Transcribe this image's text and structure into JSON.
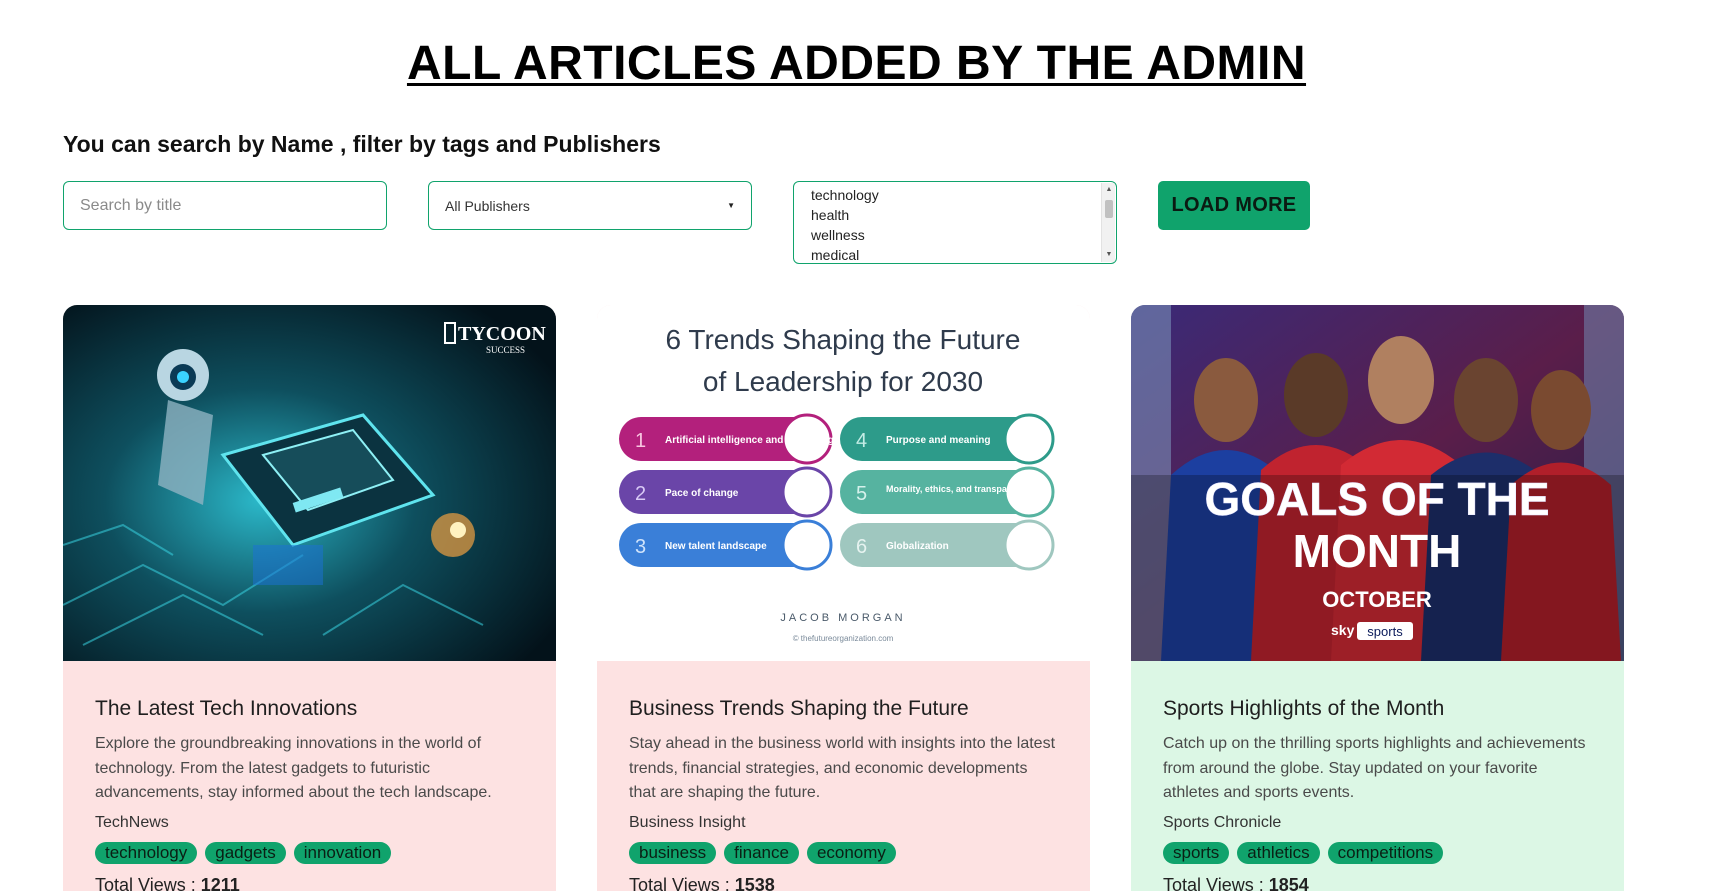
{
  "header": {
    "title": "ALL ARTICLES ADDED BY THE ADMIN",
    "subtitle": "You can search by Name , filter by tags and Publishers"
  },
  "controls": {
    "search_placeholder": "Search by title",
    "publisher_selected": "All Publishers",
    "tag_options": [
      "technology",
      "health",
      "wellness",
      "medical"
    ],
    "load_more_label": "LOAD MORE"
  },
  "cards": [
    {
      "title": "The Latest Tech Innovations",
      "description": "Explore the groundbreaking innovations in the world of technology. From the latest gadgets to futuristic advancements, stay informed about the tech landscape.",
      "publisher": "TechNews",
      "tags": [
        "technology",
        "gadgets",
        "innovation"
      ],
      "views_label": "Total Views :",
      "views": "1211",
      "image_text": {
        "logo_main": "TYCOON",
        "logo_sub": "SUCCESS"
      }
    },
    {
      "title": "Business Trends Shaping the Future",
      "description": "Stay ahead in the business world with insights into the latest trends, financial strategies, and economic developments that are shaping the future.",
      "publisher": "Business Insight",
      "tags": [
        "business",
        "finance",
        "economy"
      ],
      "views_label": "Total Views :",
      "views": "1538",
      "image_text": {
        "heading_line1": "6 Trends Shaping the Future",
        "heading_line2": "of Leadership for 2030",
        "items": [
          {
            "num": "1",
            "text": "Artificial intelligence and technology"
          },
          {
            "num": "2",
            "text": "Pace of change"
          },
          {
            "num": "3",
            "text": "New talent landscape"
          },
          {
            "num": "4",
            "text": "Purpose and meaning"
          },
          {
            "num": "5",
            "text": "Morality, ethics, and transparency"
          },
          {
            "num": "6",
            "text": "Globalization"
          }
        ],
        "brand": "JACOB MORGAN",
        "credit": "© thefutureorganization.com"
      }
    },
    {
      "title": "Sports Highlights of the Month",
      "description": "Catch up on the thrilling sports highlights and achievements from around the globe. Stay updated on your favorite athletes and sports events.",
      "publisher": "Sports Chronicle",
      "tags": [
        "sports",
        "athletics",
        "competitions"
      ],
      "views_label": "Total Views :",
      "views": "1854",
      "image_text": {
        "line1": "GOALS OF THE",
        "line2": "MONTH",
        "line3": "OCTOBER",
        "brand_a": "sky",
        "brand_b": "sports"
      }
    }
  ],
  "colors": {
    "accent": "#10a36c",
    "card_pink": "#fde2e2",
    "card_mint": "#dcf7e5"
  }
}
